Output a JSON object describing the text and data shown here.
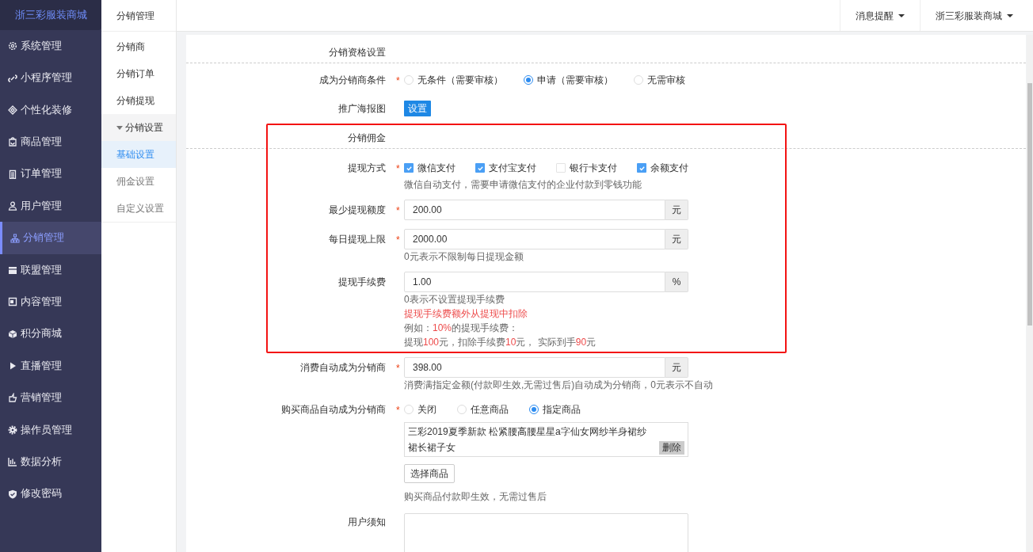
{
  "sidebar": {
    "logo": "浙三彩服装商城",
    "items": [
      {
        "label": "系统管理",
        "selected": false
      },
      {
        "label": "小程序管理",
        "selected": false
      },
      {
        "label": "个性化装修",
        "selected": false
      },
      {
        "label": "商品管理",
        "selected": false
      },
      {
        "label": "订单管理",
        "selected": false
      },
      {
        "label": "用户管理",
        "selected": false
      },
      {
        "label": "分销管理",
        "selected": true
      },
      {
        "label": "联盟管理",
        "selected": false
      },
      {
        "label": "内容管理",
        "selected": false
      },
      {
        "label": "积分商城",
        "selected": false
      },
      {
        "label": "直播管理",
        "selected": false
      },
      {
        "label": "营销管理",
        "selected": false
      },
      {
        "label": "操作员管理",
        "selected": false
      },
      {
        "label": "数据分析",
        "selected": false
      },
      {
        "label": "修改密码",
        "selected": false
      }
    ]
  },
  "submenu": {
    "title": "分销管理",
    "items": [
      {
        "label": "分销商",
        "selected": false
      },
      {
        "label": "分销订单",
        "selected": false
      },
      {
        "label": "分销提现",
        "selected": false
      },
      {
        "label": "分销设置",
        "selected": false,
        "expanded": true,
        "children": [
          {
            "label": "基础设置",
            "selected": true
          },
          {
            "label": "佣金设置",
            "selected": false
          },
          {
            "label": "自定义设置",
            "selected": false
          }
        ]
      }
    ]
  },
  "header": {
    "menus": [
      "消息提醒",
      "浙三彩服装商城"
    ]
  },
  "sections": [
    {
      "title": "分销资格设置",
      "fields": [
        {
          "kind": "radio",
          "label": "成为分销商条件",
          "mark": "*",
          "options": [
            {
              "label": "无条件（需要审核）",
              "selected": false
            },
            {
              "label": "申请（需要审核）",
              "selected": true
            },
            {
              "label": "无需审核",
              "selected": false
            }
          ]
        },
        {
          "kind": "button",
          "label": "推广海报图",
          "button": "设置"
        }
      ]
    },
    {
      "title": "分销佣金",
      "highlighted": true,
      "fields": [
        {
          "kind": "checkbox",
          "label": "提现方式",
          "mark": "*",
          "options": [
            {
              "label": "微信支付",
              "checked": true
            },
            {
              "label": "支付宝支付",
              "checked": true
            },
            {
              "label": "银行卡支付",
              "checked": false
            },
            {
              "label": "余额支付",
              "checked": true
            }
          ],
          "notes": [
            [
              {
                "text": "微信自动支付，需要申请微信支付的企业付款到零钱功能",
                "warning": false
              }
            ]
          ]
        },
        {
          "kind": "input",
          "label": "最少提现额度",
          "mark": "*",
          "value": "200.00",
          "unit": "元"
        },
        {
          "kind": "input",
          "label": "每日提现上限",
          "mark": "*",
          "value": "2000.00",
          "unit": "元",
          "notes": [
            [
              {
                "text": "0元表示不限制每日提现金额",
                "warning": false
              }
            ]
          ]
        },
        {
          "kind": "input",
          "label": "提现手续费",
          "value": "1.00",
          "unit": "%",
          "notes": [
            [
              {
                "text": "0表示不设置提现手续费",
                "warning": false
              }
            ],
            [
              {
                "text": "提现手续费额外从提现中扣除",
                "warning": true
              }
            ],
            [
              {
                "text": "例如：",
                "warning": false
              },
              {
                "text": "10%",
                "warning": true
              },
              {
                "text": "的提现手续费：",
                "warning": false
              }
            ],
            [
              {
                "text": "提现",
                "warning": false
              },
              {
                "text": "100",
                "warning": true
              },
              {
                "text": "元，扣除手续费",
                "warning": false
              },
              {
                "text": "10",
                "warning": true
              },
              {
                "text": "元， 实际到手",
                "warning": false
              },
              {
                "text": "90",
                "warning": true
              },
              {
                "text": "元",
                "warning": false
              }
            ]
          ]
        }
      ]
    },
    {
      "fields": [
        {
          "kind": "input",
          "label": "消费自动成为分销商",
          "mark": "*",
          "value": "398.00",
          "unit": "元",
          "notes": [
            [
              {
                "text": "消费满指定金额(付款即生效,无需过售后)自动成为分销商，0元表示不自动",
                "warning": false
              }
            ]
          ]
        },
        {
          "kind": "products",
          "label": "购买商品自动成为分销商",
          "mark": "*",
          "options": [
            {
              "label": "关闭",
              "selected": false
            },
            {
              "label": "任意商品",
              "selected": false
            },
            {
              "label": "指定商品",
              "selected": true
            }
          ],
          "products": [
            {
              "name": "三彩2019夏季新款 松紧腰高腰星星a字仙女网纱半身裙纱裙长裙子女",
              "action": "删除"
            }
          ],
          "button": "选择商品",
          "notes": [
            [
              {
                "text": "购买商品付款即生效，无需过售后",
                "warning": false
              }
            ]
          ]
        },
        {
          "kind": "textarea",
          "label": "用户须知"
        }
      ]
    }
  ]
}
